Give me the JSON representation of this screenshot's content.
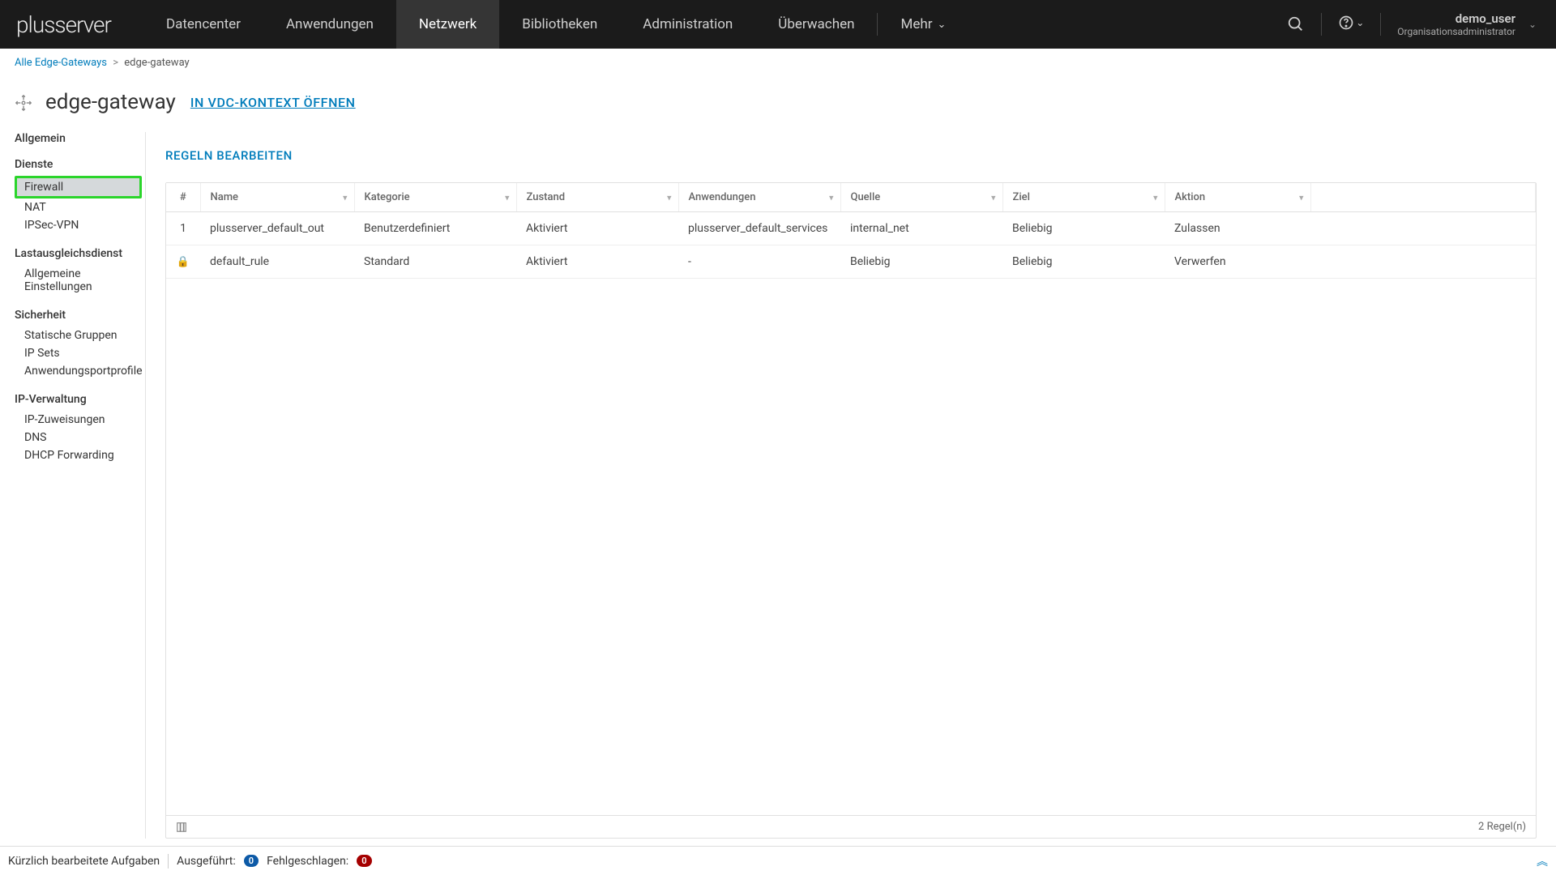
{
  "brand": "plusserver",
  "nav": {
    "items": [
      "Datencenter",
      "Anwendungen",
      "Netzwerk",
      "Bibliotheken",
      "Administration",
      "Überwachen",
      "Mehr"
    ],
    "active_index": 2
  },
  "user": {
    "name": "demo_user",
    "role": "Organisationsadministrator"
  },
  "breadcrumb": {
    "root": "Alle Edge-Gateways",
    "current": "edge-gateway"
  },
  "page": {
    "title": "edge-gateway",
    "open_link": "IN VDC-KONTEXT ÖFFNEN"
  },
  "sidebar": {
    "groups": [
      {
        "title": "Allgemein",
        "items": []
      },
      {
        "title": "Dienste",
        "items": [
          "Firewall",
          "NAT",
          "IPSec-VPN"
        ],
        "active_index": 0
      },
      {
        "title": "Lastausgleichsdienst",
        "items": [
          "Allgemeine Einstellungen"
        ]
      },
      {
        "title": "Sicherheit",
        "items": [
          "Statische Gruppen",
          "IP Sets",
          "Anwendungsportprofile"
        ]
      },
      {
        "title": "IP-Verwaltung",
        "items": [
          "IP-Zuweisungen",
          "DNS",
          "DHCP Forwarding"
        ]
      }
    ]
  },
  "content": {
    "edit_rules": "REGELN BEARBEITEN",
    "columns": [
      "#",
      "Name",
      "Kategorie",
      "Zustand",
      "Anwendungen",
      "Quelle",
      "Ziel",
      "Aktion"
    ],
    "rows": [
      {
        "num": "1",
        "name": "plusserver_default_out",
        "kategorie": "Benutzerdefiniert",
        "zustand": "Aktiviert",
        "anwendungen": "plusserver_default_services",
        "quelle": "internal_net",
        "ziel": "Beliebig",
        "aktion": "Zulassen",
        "locked": false
      },
      {
        "num": "",
        "name": "default_rule",
        "kategorie": "Standard",
        "zustand": "Aktiviert",
        "anwendungen": "-",
        "quelle": "Beliebig",
        "ziel": "Beliebig",
        "aktion": "Verwerfen",
        "locked": true
      }
    ],
    "footer_count": "2 Regel(n)"
  },
  "statusbar": {
    "recent": "Kürzlich bearbeitete Aufgaben",
    "executed_label": "Ausgeführt:",
    "executed_count": "0",
    "failed_label": "Fehlgeschlagen:",
    "failed_count": "0"
  }
}
